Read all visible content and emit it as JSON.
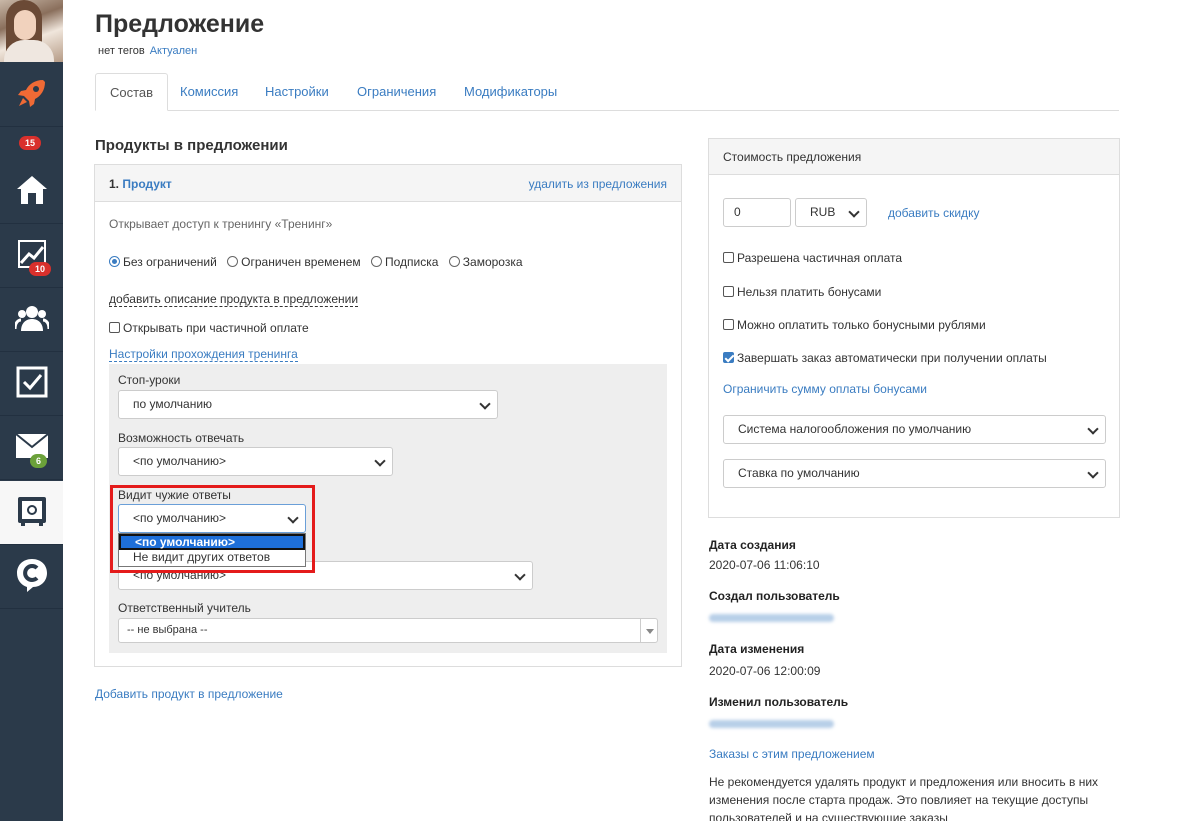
{
  "sidebar": {
    "badges": {
      "rocket": "15",
      "stats": "10",
      "mail": "6"
    }
  },
  "header": {
    "title": "Предложение",
    "tags_label": "нет тегов",
    "status_link": "Актуален"
  },
  "tabs": [
    "Состав",
    "Комиссия",
    "Настройки",
    "Ограничения",
    "Модификаторы"
  ],
  "products": {
    "section_title": "Продукты в предложении",
    "item_number": "1.",
    "item_name": "Продукт",
    "remove_link": "удалить из предложения",
    "access_text": "Открывает доступ к тренингу «Тренинг»",
    "access_options": [
      "Без ограничений",
      "Ограничен временем",
      "Подписка",
      "Заморозка"
    ],
    "add_description_link": "добавить описание продукта в предложении",
    "partial_payment_checkbox": "Открывать при частичной оплате",
    "training_settings_link": "Настройки прохождения тренинга",
    "stop_lessons_label": "Стоп-уроки",
    "stop_lessons_value": "по умолчанию",
    "can_answer_label": "Возможность отвечать",
    "can_answer_value": "<по умолчанию>",
    "sees_answers_label": "Видит чужие ответы",
    "sees_answers_value": "<по умолчанию>",
    "sees_answers_options": [
      "<по умолчанию>",
      "Не видит других ответов"
    ],
    "hidden_select_value": "<по умолчанию>",
    "teacher_label": "Ответственный учитель",
    "teacher_value": "-- не выбрана --",
    "add_product_link": "Добавить продукт в предложение"
  },
  "price": {
    "title": "Стоимость предложения",
    "amount": "0",
    "currency": "RUB",
    "add_discount_link": "добавить скидку",
    "options": [
      {
        "label": "Разрешена частичная оплата",
        "checked": false
      },
      {
        "label": "Нельзя платить бонусами",
        "checked": false
      },
      {
        "label": "Можно оплатить только бонусными рублями",
        "checked": false
      },
      {
        "label": "Завершать заказ автоматически при получении оплаты",
        "checked": true
      }
    ],
    "limit_bonus_link": "Ограничить сумму оплаты бонусами",
    "tax_system": "Система налогообложения по умолчанию",
    "tax_rate": "Ставка по умолчанию"
  },
  "meta": {
    "created_label": "Дата создания",
    "created_value": "2020-07-06 11:06:10",
    "created_by_label": "Создал пользователь",
    "modified_label": "Дата изменения",
    "modified_value": "2020-07-06 12:00:09",
    "modified_by_label": "Изменил пользователь",
    "orders_link": "Заказы с этим предложением",
    "note": "Не рекомендуется удалять продукт и предложения или вносить в них изменения после старта продаж. Это повлияет на текущие доступы пользователей и на существующие заказы"
  },
  "colors": {
    "sidebar": "#2b3a4a",
    "link": "#3a7cc1",
    "highlight": "#e41b1b",
    "badge_red": "#d9302c",
    "badge_green": "#6ba13a",
    "rocket": "#f06a35"
  }
}
